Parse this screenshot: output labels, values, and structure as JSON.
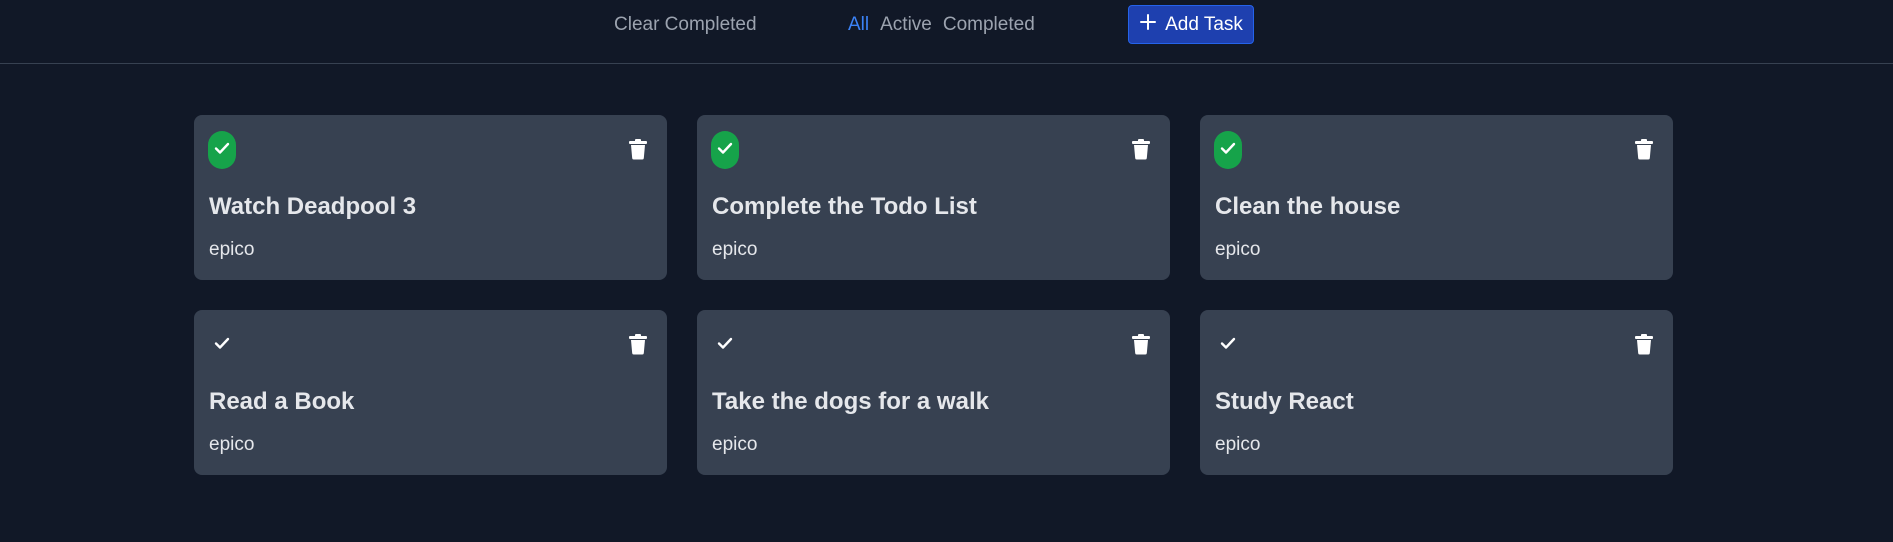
{
  "toolbar": {
    "clear_completed": "Clear Completed",
    "filters": [
      "All",
      "Active",
      "Completed"
    ],
    "active_filter": "All",
    "add_task": "Add Task"
  },
  "colors": {
    "background": "#111827",
    "card": "#374151",
    "accent_blue": "#3b82f6",
    "button_blue": "#1e40af",
    "done_green": "#16a34a"
  },
  "tasks": [
    {
      "title": "Watch Deadpool 3",
      "user": "epico",
      "completed": true
    },
    {
      "title": "Complete the Todo List",
      "user": "epico",
      "completed": true
    },
    {
      "title": "Clean the house",
      "user": "epico",
      "completed": true
    },
    {
      "title": "Read a Book",
      "user": "epico",
      "completed": false
    },
    {
      "title": "Take the dogs for a walk",
      "user": "epico",
      "completed": false
    },
    {
      "title": "Study React",
      "user": "epico",
      "completed": false
    }
  ],
  "icons": {
    "check": "check-icon",
    "trash": "trash-icon",
    "plus": "plus-icon"
  }
}
